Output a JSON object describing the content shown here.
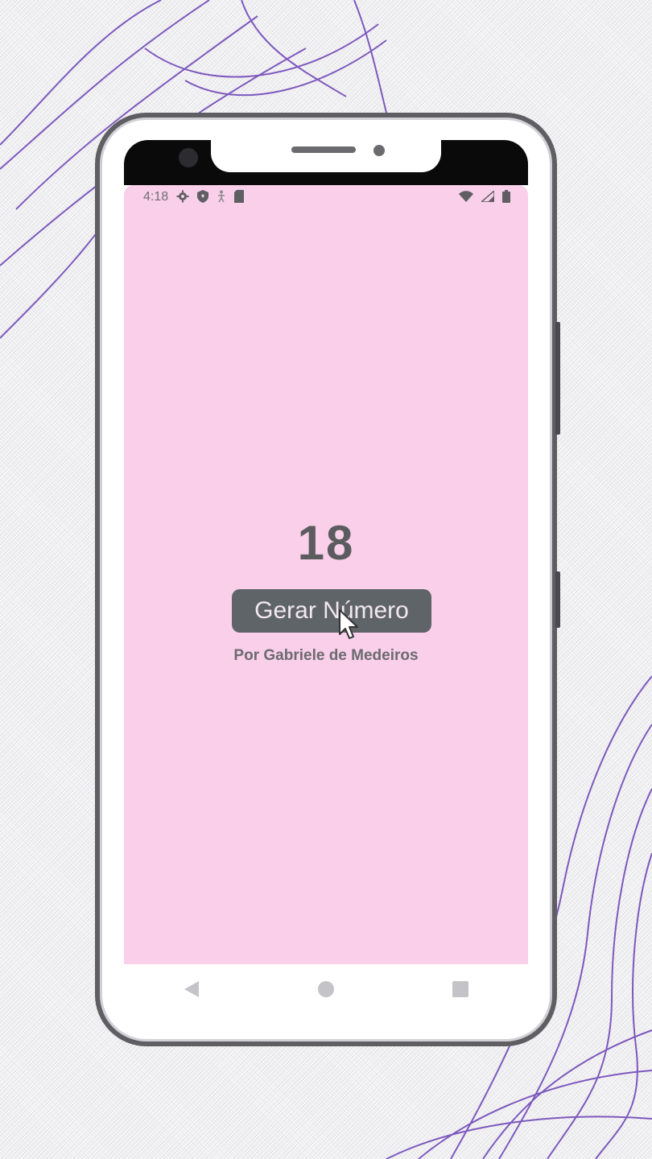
{
  "status_bar": {
    "time": "4:18",
    "left_icons": [
      "gear-icon",
      "shield-icon",
      "accessibility-icon",
      "sim-card-icon"
    ],
    "right_icons": [
      "wifi-icon",
      "signal-icon",
      "battery-icon"
    ]
  },
  "app": {
    "number": "18",
    "button_label": "Gerar Número",
    "author": "Por Gabriele de Medeiros",
    "background_color": "#f9cfe9",
    "button_color": "#5f6468",
    "text_color": "#5c5c60"
  },
  "nav_bar": {
    "buttons": [
      "back-icon",
      "home-icon",
      "recents-icon"
    ]
  },
  "decor": {
    "line_color": "#6a3fb5"
  }
}
